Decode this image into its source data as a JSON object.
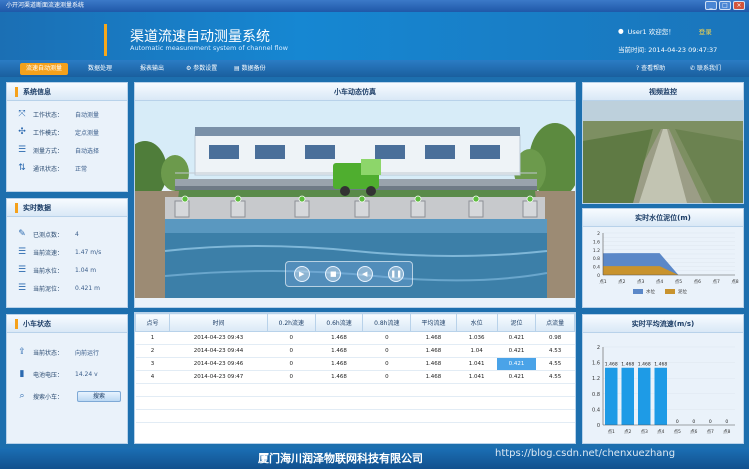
{
  "window": {
    "title": "小开河渠道断面流速测量系统"
  },
  "header": {
    "title": "渠道流速自动测量系统",
    "subtitle": "Automatic measurement system of channel flow",
    "welcome": "User1 欢迎您！",
    "login": "登录",
    "time_label": "当前时间:",
    "time_value": "2014-04-23 09:47:37"
  },
  "menu": {
    "items": [
      "流速自动测量",
      "数据处理",
      "报表输出",
      "参数设置",
      "数据备份"
    ],
    "help": "查看帮助",
    "contact": "联系我们"
  },
  "system_info": {
    "title": "系统信息",
    "rows": [
      {
        "label": "工作状态：",
        "value": "自动测量"
      },
      {
        "label": "工作模式：",
        "value": "定点测量"
      },
      {
        "label": "测量方式：",
        "value": "自动选择"
      },
      {
        "label": "通讯状态：",
        "value": "正常"
      }
    ]
  },
  "realtime": {
    "title": "实时数据",
    "rows": [
      {
        "label": "已测点数：",
        "value": "4"
      },
      {
        "label": "当前流速：",
        "value": "1.47 m/s"
      },
      {
        "label": "当前水位：",
        "value": "1.04 m"
      },
      {
        "label": "当前泥位：",
        "value": "0.421 m"
      }
    ]
  },
  "cart": {
    "title": "小车状态",
    "rows": [
      {
        "label": "当前状态：",
        "value": "向前运行"
      },
      {
        "label": "电池电压：",
        "value": "14.24 v"
      }
    ],
    "search_label": "搜索小车：",
    "search_button": "搜索"
  },
  "simulation": {
    "title": "小车动态仿真"
  },
  "video": {
    "title": "视频监控"
  },
  "table": {
    "headers": [
      "点号",
      "时间",
      "0.2h流速",
      "0.6h流速",
      "0.8h流速",
      "平均流速",
      "水位",
      "泥位",
      "点流量"
    ],
    "rows": [
      [
        "1",
        "2014-04-23 09:43",
        "0",
        "1.468",
        "0",
        "1.468",
        "1.036",
        "0.421",
        "0.98"
      ],
      [
        "2",
        "2014-04-23 09:44",
        "0",
        "1.468",
        "0",
        "1.468",
        "1.04",
        "0.421",
        "4.53"
      ],
      [
        "3",
        "2014-04-23 09:46",
        "0",
        "1.468",
        "0",
        "1.468",
        "1.041",
        "0.421",
        "4.55"
      ],
      [
        "4",
        "2014-04-23 09:47",
        "0",
        "1.468",
        "0",
        "1.468",
        "1.041",
        "0.421",
        "4.55"
      ]
    ]
  },
  "level_chart": {
    "title": "实时水位泥位(m)",
    "categories": [
      "点1",
      "点2",
      "点3",
      "点4",
      "点5",
      "点6",
      "点7",
      "点8"
    ],
    "yticks": [
      "0",
      "0.2",
      "0.4",
      "0.6",
      "0.8",
      "1",
      "1.2",
      "1.4",
      "1.6",
      "1.8",
      "2"
    ],
    "legend": [
      "水位",
      "泥位"
    ],
    "water": [
      1.036,
      1.04,
      1.041,
      1.041,
      0,
      0,
      0,
      0
    ],
    "mud": [
      0.421,
      0.421,
      0.421,
      0.421,
      0,
      0,
      0,
      0
    ],
    "colors": {
      "water": "#5b88c8",
      "mud": "#c8932e"
    }
  },
  "speed_chart": {
    "title": "实时平均流速(m/s)",
    "categories": [
      "点1",
      "点2",
      "点3",
      "点4",
      "点5",
      "点6",
      "点7",
      "点8"
    ],
    "yticks": [
      "0",
      "0.4",
      "0.8",
      "1.2",
      "1.6",
      "2"
    ],
    "values": [
      1.468,
      1.468,
      1.468,
      1.468,
      0,
      0,
      0,
      0
    ],
    "labels": [
      "1.468",
      "1.468",
      "1.468",
      "1.468",
      "0",
      "0",
      "0",
      "0"
    ],
    "color": "#1e9be6"
  },
  "footer": {
    "company": "厦门海川润泽物联网科技有限公司",
    "watermark": "https://blog.csdn.net/chenxuezhang"
  }
}
